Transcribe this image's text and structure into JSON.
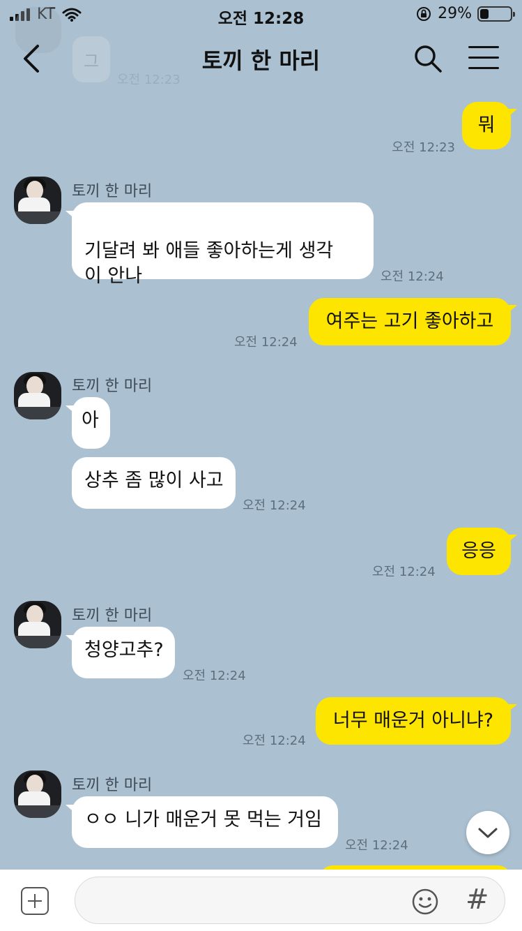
{
  "status_bar": {
    "carrier": "KT",
    "time": "오전 12:28",
    "battery_percent": "29%",
    "battery_level": 0.29
  },
  "header": {
    "title": "토끼 한 마리"
  },
  "ghost": {
    "text": "그",
    "time": "오전 12:23"
  },
  "messages": [
    {
      "id": "m1",
      "direction": "out",
      "text": "뭐",
      "time": "오전 12:23"
    },
    {
      "id": "m2",
      "direction": "in",
      "sender": "토끼 한 마리",
      "text": "기달려 봐 애들 좋아하는게 생각\n이 안나",
      "time": "오전 12:24"
    },
    {
      "id": "m3",
      "direction": "out",
      "text": "여주는 고기 좋아하고",
      "time": "오전 12:24"
    },
    {
      "id": "m4",
      "direction": "in",
      "sender": "토끼 한 마리",
      "text": "아"
    },
    {
      "id": "m5",
      "direction": "in",
      "text": "상추 좀 많이 사고",
      "time": "오전 12:24"
    },
    {
      "id": "m6",
      "direction": "out",
      "text": "응응",
      "time": "오전 12:24"
    },
    {
      "id": "m7",
      "direction": "in",
      "sender": "토끼 한 마리",
      "text": "청양고추?",
      "time": "오전 12:24"
    },
    {
      "id": "m8",
      "direction": "out",
      "text": "너무 매운거 아니냐?",
      "time": "오전 12:24"
    },
    {
      "id": "m9",
      "direction": "in",
      "sender": "토끼 한 마리",
      "text": "ㅇㅇ 니가 매운거 못 먹는 거임",
      "time": "오전 12:24"
    }
  ],
  "icons": {
    "back": "chevron-left-icon",
    "search": "search-icon",
    "menu": "hamburger-menu-icon",
    "scroll_down": "chevron-down-icon",
    "attach": "plus-square-icon",
    "emoji": "smiley-icon",
    "hashtag": "hashtag-icon"
  },
  "colors": {
    "background": "#abc1d1",
    "outgoing_bubble": "#fee500",
    "incoming_bubble": "#ffffff"
  }
}
